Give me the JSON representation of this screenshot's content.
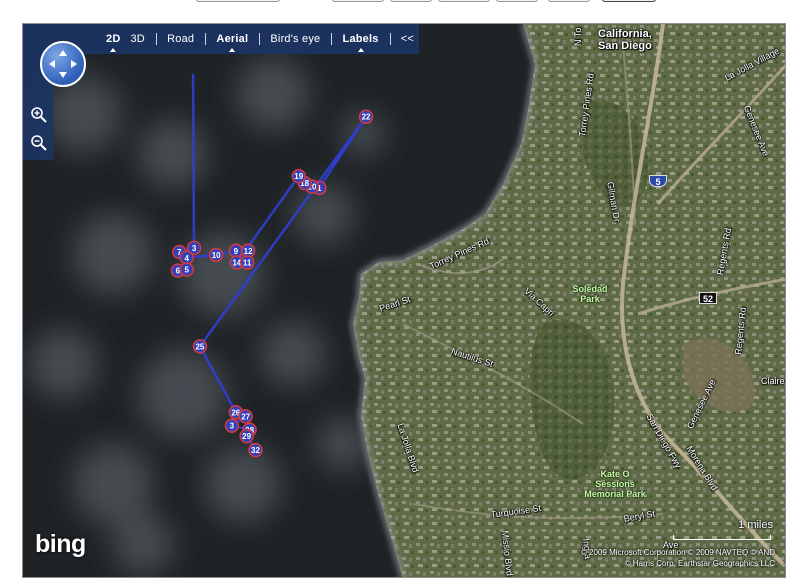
{
  "nav": {
    "items": [
      {
        "key": "2d",
        "label": "2D",
        "active": true,
        "bold": true
      },
      {
        "key": "3d",
        "label": "3D",
        "active": false,
        "bold": false
      },
      {
        "key": "road",
        "label": "Road",
        "active": false,
        "bold": false
      },
      {
        "key": "aerial",
        "label": "Aerial",
        "active": true,
        "bold": true
      },
      {
        "key": "birdseye",
        "label": "Bird's eye",
        "active": false,
        "bold": false
      },
      {
        "key": "labels",
        "label": "Labels",
        "active": true,
        "bold": true
      },
      {
        "key": "collapse",
        "label": "<<",
        "active": false,
        "bold": false
      }
    ]
  },
  "map": {
    "place_title_line1": "California,",
    "place_title_line2": "San Diego",
    "route_color": "#2f3fd6",
    "marker_fill": "#3340b8",
    "marker_border": "#d83a3a",
    "roads": [
      {
        "key": "torrey-pines-rd-n",
        "text": "Torrey Pines Rd"
      },
      {
        "key": "n-torrey",
        "text": "N To"
      },
      {
        "key": "la-jolla-village",
        "text": "La Jolla Village"
      },
      {
        "key": "genesee-ave",
        "text": "Genesee Ave"
      },
      {
        "key": "gilman-dr",
        "text": "Gilman Dr"
      },
      {
        "key": "torrey-pines-rd-s",
        "text": "Torrey Pines Rd"
      },
      {
        "key": "regents-rd-n",
        "text": "Regents Rd"
      },
      {
        "key": "via-capri",
        "text": "Via Capri"
      },
      {
        "key": "pearl-st",
        "text": "Pearl St"
      },
      {
        "key": "nautilus-st",
        "text": "Nautilus St"
      },
      {
        "key": "regents-rd-s",
        "text": "Regents Rd"
      },
      {
        "key": "clairemont",
        "text": "Claire"
      },
      {
        "key": "genesee-s",
        "text": "Genesee Ave"
      },
      {
        "key": "san-diego-fwy",
        "text": "San Diego Fwy"
      },
      {
        "key": "morena-blvd",
        "text": "Morena Blvd"
      },
      {
        "key": "la-jolla-blvd",
        "text": "La Jolla Blvd"
      },
      {
        "key": "turquoise-st",
        "text": "Turquoise St"
      },
      {
        "key": "beryl-st",
        "text": "Beryl St"
      },
      {
        "key": "mission-blvd",
        "text": "Missio Blvd"
      },
      {
        "key": "ingraham",
        "text": "Ingra"
      },
      {
        "key": "ave",
        "text": "Ave"
      }
    ],
    "parks": [
      {
        "key": "soledad",
        "line1": "Soledad",
        "line2": "Park",
        "line3": ""
      },
      {
        "key": "kate-o-sessions",
        "line1": "Kate O",
        "line2": "Sessions",
        "line3": "Memorial Park"
      }
    ],
    "shields": [
      {
        "key": "i5",
        "text": "5"
      },
      {
        "key": "sr52",
        "text": "52"
      }
    ],
    "markers": [
      {
        "n": "22",
        "lon": -117.2395,
        "lat": 32.8712
      },
      {
        "n": "1",
        "lon": -117.249,
        "lat": 32.859
      },
      {
        "n": "20",
        "lon": -117.2505,
        "lat": 32.8592
      },
      {
        "n": "18",
        "lon": -117.252,
        "lat": 32.8598
      },
      {
        "n": "19",
        "lon": -117.2532,
        "lat": 32.861
      },
      {
        "n": "3",
        "lon": -117.2745,
        "lat": 32.8487
      },
      {
        "n": "7",
        "lon": -117.2775,
        "lat": 32.848
      },
      {
        "n": "4",
        "lon": -117.276,
        "lat": 32.847
      },
      {
        "n": "10",
        "lon": -117.27,
        "lat": 32.8475
      },
      {
        "n": "9",
        "lon": -117.266,
        "lat": 32.8482
      },
      {
        "n": "12",
        "lon": -117.2635,
        "lat": 32.8482
      },
      {
        "n": "14",
        "lon": -117.2658,
        "lat": 32.8462
      },
      {
        "n": "11",
        "lon": -117.2637,
        "lat": 32.8462
      },
      {
        "n": "6",
        "lon": -117.2778,
        "lat": 32.8448
      },
      {
        "n": "5",
        "lon": -117.276,
        "lat": 32.845
      },
      {
        "n": "25",
        "lon": -117.2733,
        "lat": 32.8318
      },
      {
        "n": "26",
        "lon": -117.266,
        "lat": 32.8205
      },
      {
        "n": "27",
        "lon": -117.264,
        "lat": 32.8198
      },
      {
        "n": "3",
        "lon": -117.2668,
        "lat": 32.8182
      },
      {
        "n": "28",
        "lon": -117.2632,
        "lat": 32.8175
      },
      {
        "n": "29",
        "lon": -117.2638,
        "lat": 32.8164
      },
      {
        "n": "32",
        "lon": -117.262,
        "lat": 32.814
      }
    ],
    "route_order": [
      "3",
      "7",
      "4",
      "10",
      "9",
      "12",
      "11",
      "14",
      "19",
      "18",
      "20",
      "1",
      "22",
      "25",
      "26",
      "27",
      "3",
      "28",
      "29",
      "32"
    ],
    "route_start_offscreen": {
      "lon": -117.2747,
      "lat": 32.8785
    }
  },
  "footer": {
    "logo": "bing",
    "scale_text": "1 miles",
    "copyright_line1": "© 2009 Microsoft Corporation    © 2009 NAVTEQ    © AND",
    "copyright_line2": "© Harris Corp, Earthstar Geographics LLC"
  }
}
